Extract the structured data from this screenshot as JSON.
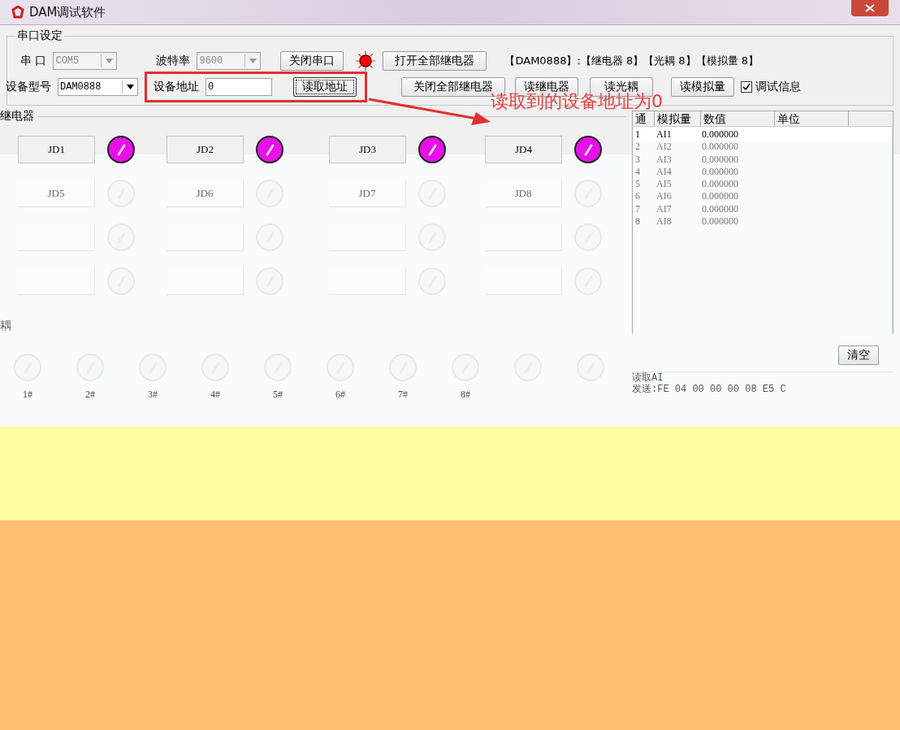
{
  "window": {
    "title": "DAM调试软件"
  },
  "serial": {
    "title": "串口设定",
    "port_label": "串 口",
    "port": "COM5",
    "baud_label": "波特率",
    "baud": "9600",
    "toggle_port": "关闭串口",
    "port_lamp_on": true,
    "open_all": "打开全部继电器",
    "close_all": "关闭全部继电器",
    "summary": "【DAM0888】:【继电器  8】【光耦 8】【模拟量 8】",
    "model_label": "设备型号",
    "model": "DAM0888",
    "address_label": "设备地址",
    "address": "0",
    "read_address": "读取地址",
    "read_relay": "读继电器",
    "read_opto": "读光耦",
    "read_analog": "读模拟量",
    "debug": {
      "label": "调试信息",
      "checked": true
    }
  },
  "annotation": "读取到的设备地址为0",
  "relays": {
    "title": "继电器",
    "items": [
      {
        "label": "JD1",
        "on": true
      },
      {
        "label": "JD2",
        "on": true
      },
      {
        "label": "JD3",
        "on": true
      },
      {
        "label": "JD4",
        "on": true
      },
      {
        "label": "JD5",
        "on": false
      },
      {
        "label": "JD6",
        "on": false
      },
      {
        "label": "JD7",
        "on": false
      },
      {
        "label": "JD8",
        "on": false
      },
      {
        "on": false
      },
      {
        "on": false
      },
      {
        "on": false
      },
      {
        "on": false
      },
      {
        "on": false
      },
      {
        "on": false
      },
      {
        "on": false
      },
      {
        "on": false
      }
    ]
  },
  "opto": {
    "title": "耦",
    "items": [
      {
        "label": "1#",
        "on": false
      },
      {
        "label": "2#",
        "on": false
      },
      {
        "label": "3#",
        "on": false
      },
      {
        "label": "4#",
        "on": false
      },
      {
        "label": "5#",
        "on": false
      },
      {
        "label": "6#",
        "on": false
      },
      {
        "label": "7#",
        "on": false
      },
      {
        "label": "8#",
        "on": false
      },
      {
        "on": false
      },
      {
        "on": false
      }
    ]
  },
  "analog_table": {
    "columns": [
      "通",
      "模拟量",
      "数值",
      "单位"
    ],
    "rows": [
      [
        "1",
        "AI1",
        "0.000000"
      ],
      [
        "2",
        "AI2",
        "0.000000"
      ],
      [
        "3",
        "AI3",
        "0.000000"
      ],
      [
        "4",
        "AI4",
        "0.000000"
      ],
      [
        "5",
        "AI5",
        "0.000000"
      ],
      [
        "6",
        "AI6",
        "0.000000"
      ],
      [
        "7",
        "AI7",
        "0.000000"
      ],
      [
        "8",
        "AI8",
        "0.000000"
      ]
    ]
  },
  "clear_button": "清空",
  "log": [
    "读取AI",
    "发送:FE 04 00 00 00 08 E5 C"
  ]
}
